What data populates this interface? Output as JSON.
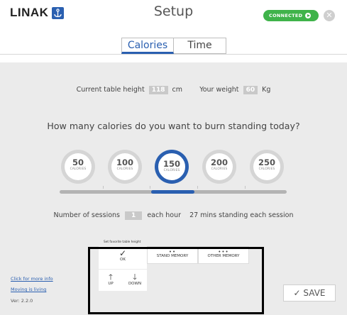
{
  "header": {
    "logo_text": "LINAK",
    "title": "Setup",
    "status_badge": "CONNECTED"
  },
  "tabs": [
    {
      "label": "Calories",
      "active": true
    },
    {
      "label": "Time",
      "active": false
    }
  ],
  "info": {
    "table_height_label": "Current table height",
    "table_height_value": "118",
    "table_height_unit": "cm",
    "weight_label": "Your weight",
    "weight_value": "60",
    "weight_unit": "Kg"
  },
  "question": "How many calories do you want to burn standing today?",
  "calorie_options": [
    {
      "value": "50",
      "unit": "CALORIES"
    },
    {
      "value": "100",
      "unit": "CALORIES"
    },
    {
      "value": "150",
      "unit": "CALORIES",
      "selected": true
    },
    {
      "value": "200",
      "unit": "CALORIES"
    },
    {
      "value": "250",
      "unit": "CALORIES"
    }
  ],
  "slider": {
    "selected_index": 2
  },
  "sessions": {
    "label": "Number of sessions",
    "value": "1",
    "suffix": "each hour",
    "standing": "27 mins standing each session"
  },
  "favorite": {
    "label": "Set favorite table height",
    "ok": "OK",
    "stand_memory": "STAND MEMORY",
    "other_memory": "OTHER MEMORY",
    "up": "UP",
    "down": "DOWN"
  },
  "footer": {
    "more_info": "Click for more info",
    "moving": "Moving is living",
    "version": "Ver: 2.2.0",
    "save": "SAVE"
  },
  "colors": {
    "accent": "#2a5fb0",
    "connected": "#3fb34a",
    "background": "#ebebeb"
  }
}
